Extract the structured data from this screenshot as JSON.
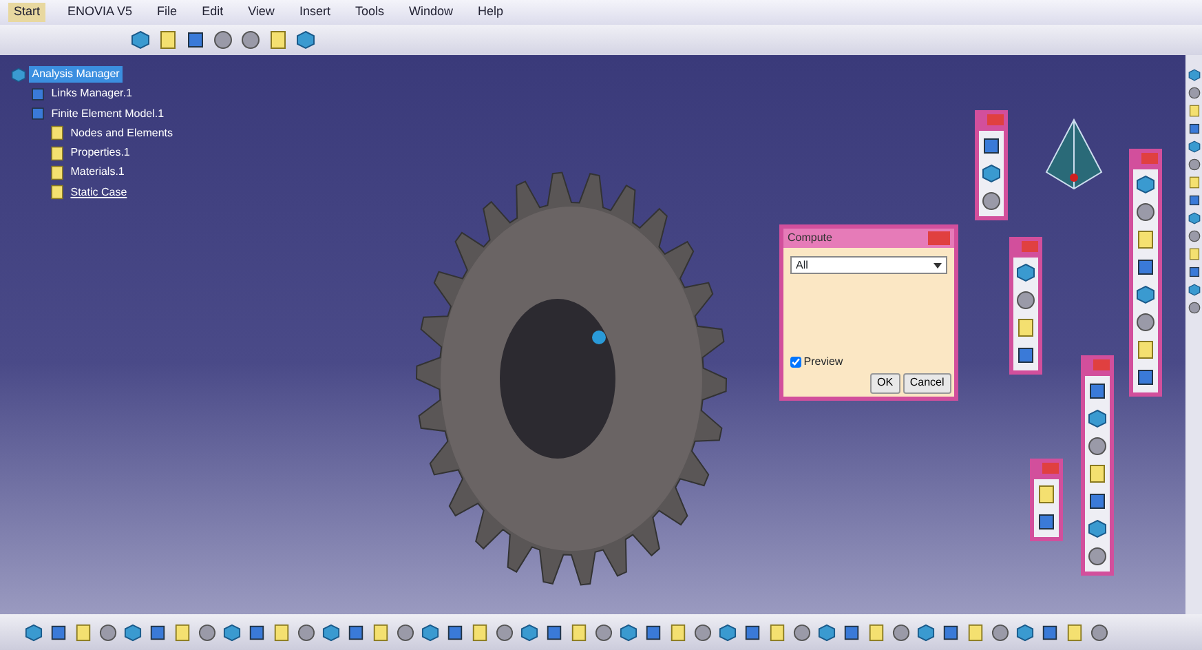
{
  "menu_bar": {
    "start": "Start",
    "items": [
      "ENOVIA V5",
      "File",
      "Edit",
      "View",
      "Insert",
      "Tools",
      "Window",
      "Help"
    ]
  },
  "tree": {
    "label": "Analysis Manager",
    "selected": true,
    "children": [
      {
        "label": "Links Manager.1",
        "selected": false
      },
      {
        "label": "Finite Element Model.1",
        "selected": false,
        "children": [
          {
            "label": "Nodes and Elements",
            "selected": false
          },
          {
            "label": "Properties.1",
            "selected": false
          },
          {
            "label": "Materials.1",
            "selected": false
          },
          {
            "label": "Static Case",
            "selected": false
          }
        ]
      }
    ]
  },
  "dialog": {
    "title": "Compute",
    "dropdown": "All",
    "preview": {
      "label": "Preview",
      "checked": true
    },
    "buttons": [
      "OK",
      "Cancel"
    ]
  }
}
